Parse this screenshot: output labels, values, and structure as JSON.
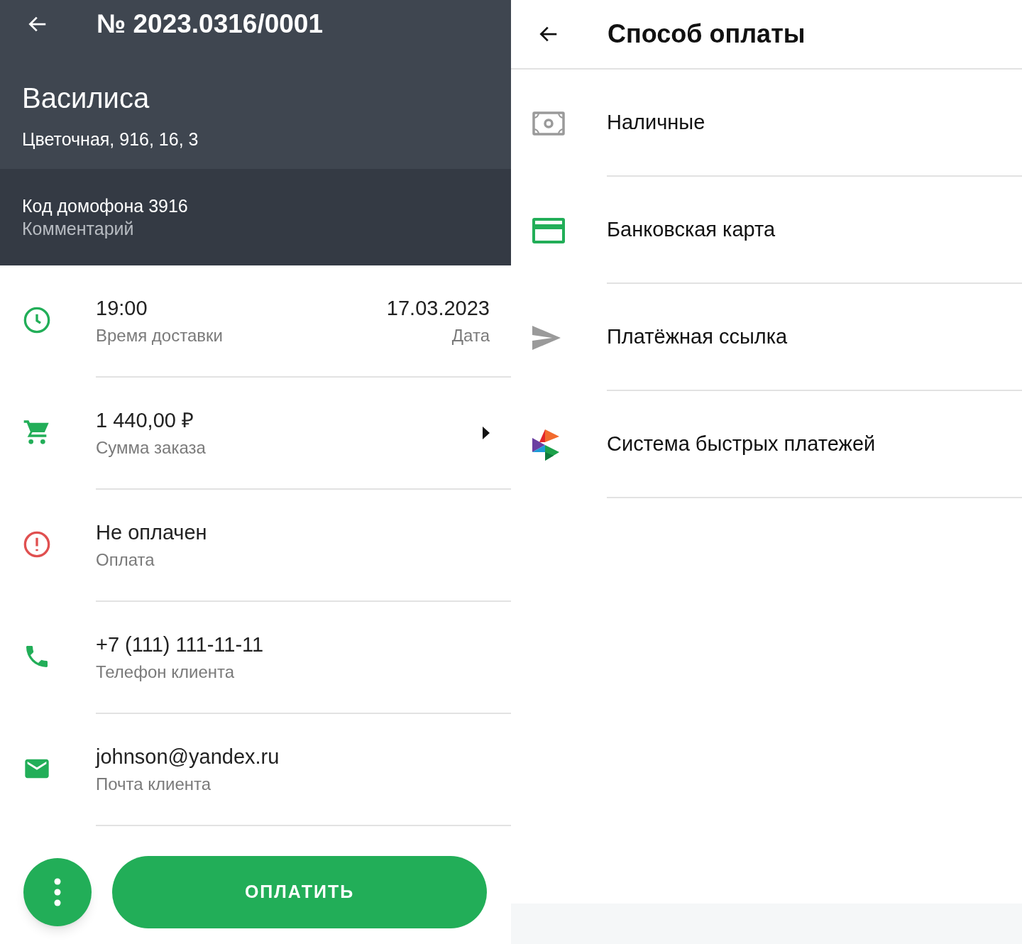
{
  "order": {
    "title": "№ 2023.0316/0001",
    "customer": "Василиса",
    "address": "Цветочная, 916, 16, 3",
    "comment": "Код домофона 3916",
    "comment_label": "Комментарий",
    "rows": [
      {
        "kind": "time",
        "value": "19:00",
        "label": "Время доставки",
        "side_value": "17.03.2023",
        "side_label": "Дата"
      },
      {
        "kind": "amount",
        "value": "1 440,00 ₽",
        "label": "Сумма заказа"
      },
      {
        "kind": "payment",
        "value": "Не оплачен",
        "label": "Оплата",
        "paid": false
      },
      {
        "kind": "phone",
        "value": "+7 (111) 111-11-11",
        "label": "Телефон клиента"
      },
      {
        "kind": "email",
        "value": "johnson@yandex.ru",
        "label": "Почта клиента"
      }
    ],
    "pay_button": "ОПЛАТИТЬ"
  },
  "payment_sheet": {
    "title": "Способ оплаты",
    "methods": [
      {
        "kind": "cash",
        "label": "Наличные"
      },
      {
        "kind": "card",
        "label": "Банковская карта"
      },
      {
        "kind": "link",
        "label": "Платёжная ссылка"
      },
      {
        "kind": "sbp",
        "label": "Система быстрых платежей"
      }
    ]
  }
}
